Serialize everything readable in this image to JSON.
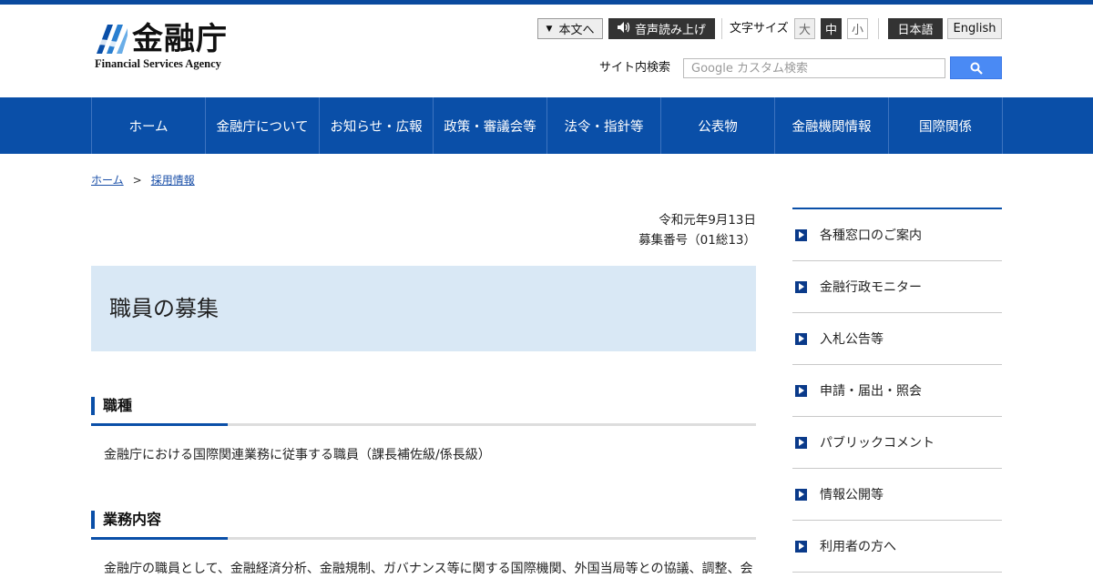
{
  "header": {
    "logo_name": "金融庁",
    "logo_sub": "Financial Services Agency",
    "skip_label": "本文へ",
    "voice_label": "音声読み上げ",
    "font_size_label": "文字サイズ",
    "font_large": "大",
    "font_medium": "中",
    "font_small": "小",
    "lang_ja": "日本語",
    "lang_en": "English",
    "search_label": "サイト内検索",
    "search_placeholder": "Google カスタム検索",
    "accent_color": "#0a4fa8"
  },
  "nav": {
    "items": [
      {
        "label": "ホーム"
      },
      {
        "label": "金融庁について"
      },
      {
        "label": "お知らせ・広報"
      },
      {
        "label": "政策・審議会等"
      },
      {
        "label": "法令・指針等"
      },
      {
        "label": "公表物"
      },
      {
        "label": "金融機関情報"
      },
      {
        "label": "国際関係"
      }
    ]
  },
  "breadcrumb": {
    "home": "ホーム",
    "separator": ">",
    "current": "採用情報"
  },
  "main": {
    "date": "令和元年9月13日",
    "recruit_no": "募集番号（01総13）",
    "title": "職員の募集",
    "sections": [
      {
        "heading": "職種",
        "body": "金融庁における国際関連業務に従事する職員（課長補佐級/係長級）"
      },
      {
        "heading": "業務内容",
        "body": "金融庁の職員として、金融経済分析、金融規制、ガバナンス等に関する国際機関、外国当局等との協議、調整、会"
      }
    ]
  },
  "sidebar": {
    "items": [
      {
        "label": "各種窓口のご案内"
      },
      {
        "label": "金融行政モニター"
      },
      {
        "label": "入札公告等"
      },
      {
        "label": "申請・届出・照会"
      },
      {
        "label": "パブリックコメント"
      },
      {
        "label": "情報公開等"
      },
      {
        "label": "利用者の方へ"
      }
    ]
  }
}
